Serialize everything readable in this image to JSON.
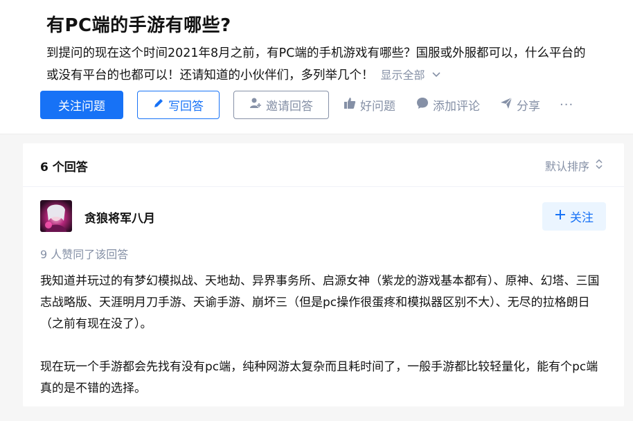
{
  "question": {
    "title": "有PC端的手游有哪些?",
    "detail_line1": "到提问的现在这个时间2021年8月之前，有PC端的手机游戏有哪些？国服或外服都可以，什么平台的",
    "detail_line2": "或没有平台的也都可以！还请知道的小伙伴们，多列举几个！",
    "show_all": "显示全部"
  },
  "actions": {
    "follow": "关注问题",
    "write": "写回答",
    "invite": "邀请回答",
    "good": "好问题",
    "comment": "添加评论",
    "share": "分享",
    "more": "···"
  },
  "answers": {
    "count": "6 个回答",
    "sort": "默认排序"
  },
  "answer": {
    "author": "贪狼将军八月",
    "follow": "关注",
    "voters": "9 人赞同了该回答",
    "paragraph1": "我知道并玩过的有梦幻模拟战、天地劫、异界事务所、启源女神（紫龙的游戏基本都有）、原神、幻塔、三国志战略版、天涯明月刀手游、天谕手游、崩坏三（但是pc操作很蛋疼和模拟器区别不大）、无尽的拉格朗日（之前有现在没了）。",
    "paragraph2": "现在玩一个手游都会先找有没有pc端，纯种网游太复杂而且耗时间了，一般手游都比较轻量化，能有个pc端真的是不错的选择。"
  },
  "colors": {
    "brand_blue": "#1772f6",
    "gray_text": "#8590a6",
    "follow_bg": "#ebf5ff"
  }
}
